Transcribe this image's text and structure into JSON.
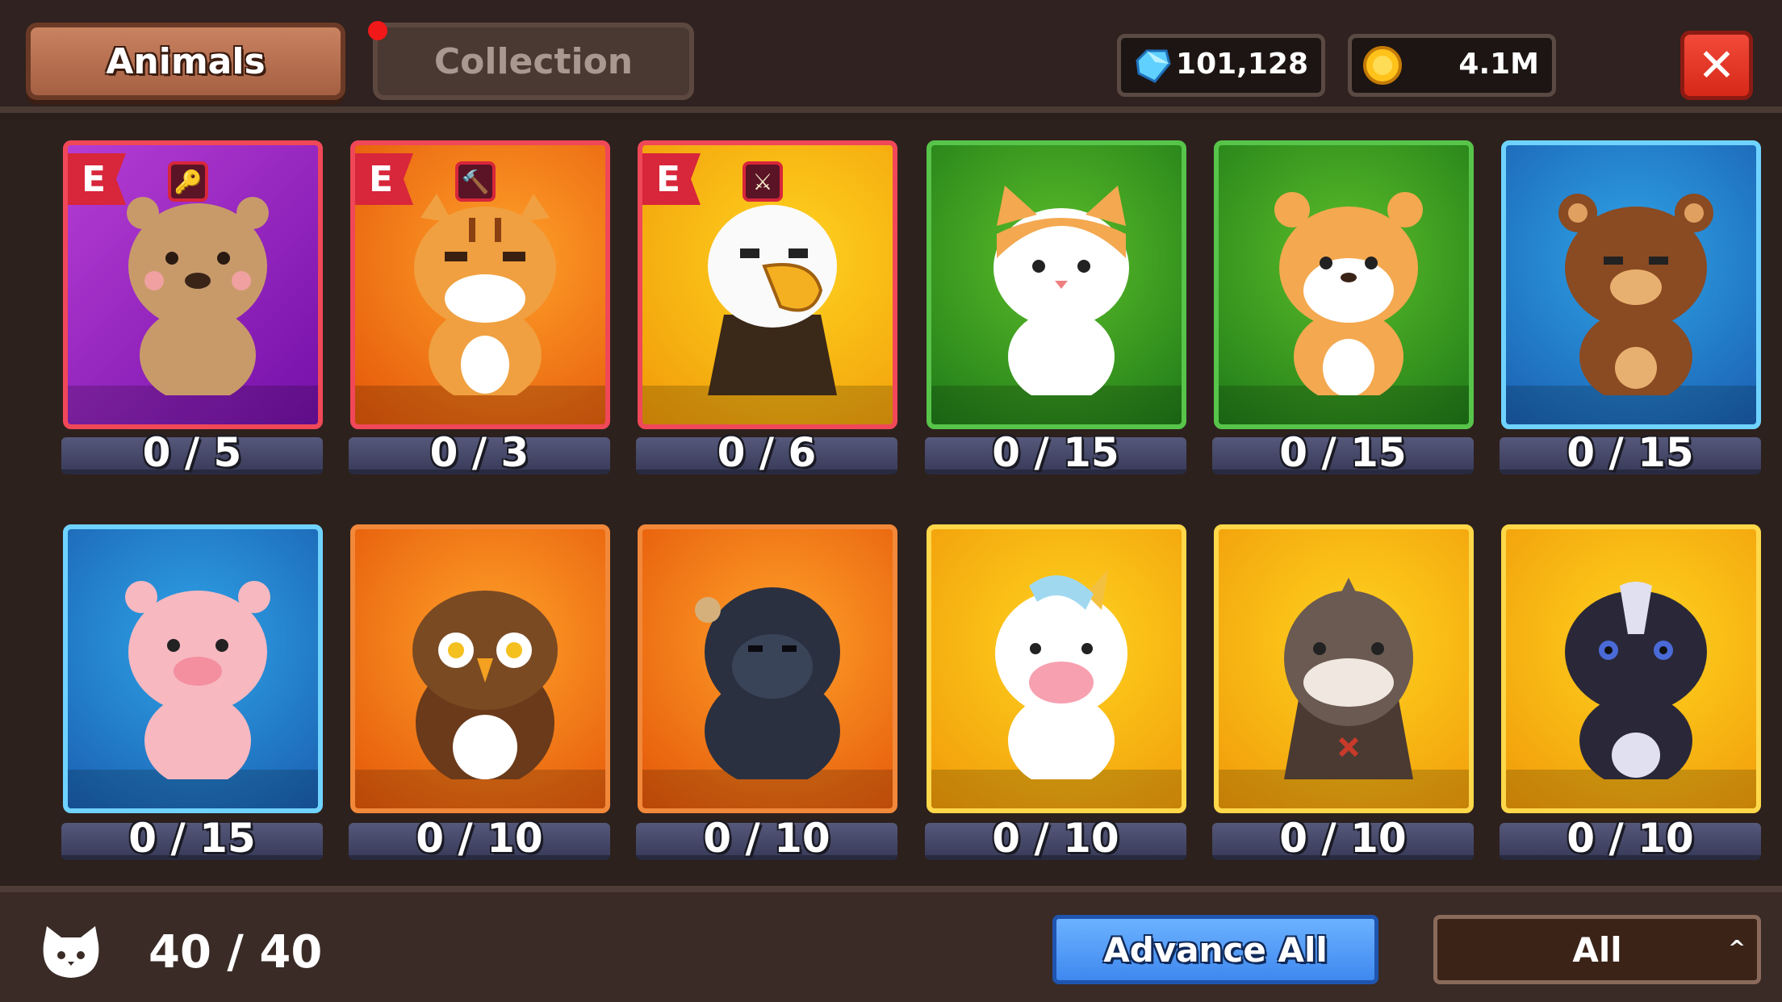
{
  "tabs": {
    "animals": "Animals",
    "collection": "Collection"
  },
  "currency": {
    "gems": "101,128",
    "gold": "4.1M"
  },
  "close_label": "✕",
  "cards": [
    {
      "rarity_badge": "E",
      "tool_icon": "🔑",
      "count": "0 / 5"
    },
    {
      "rarity_badge": "E",
      "tool_icon": "🔨",
      "count": "0 / 3"
    },
    {
      "rarity_badge": "E",
      "tool_icon": "⚔",
      "count": "0 / 6"
    },
    {
      "count": "0 / 15"
    },
    {
      "count": "0 / 15"
    },
    {
      "count": "0 / 15"
    },
    {
      "count": "0 / 15"
    },
    {
      "count": "0 / 10"
    },
    {
      "count": "0 / 10"
    },
    {
      "count": "0 / 10"
    },
    {
      "count": "0 / 10"
    },
    {
      "count": "0 / 10"
    }
  ],
  "capacity": "40 / 40",
  "advance_all": "Advance All",
  "filter": {
    "selected": "All"
  }
}
